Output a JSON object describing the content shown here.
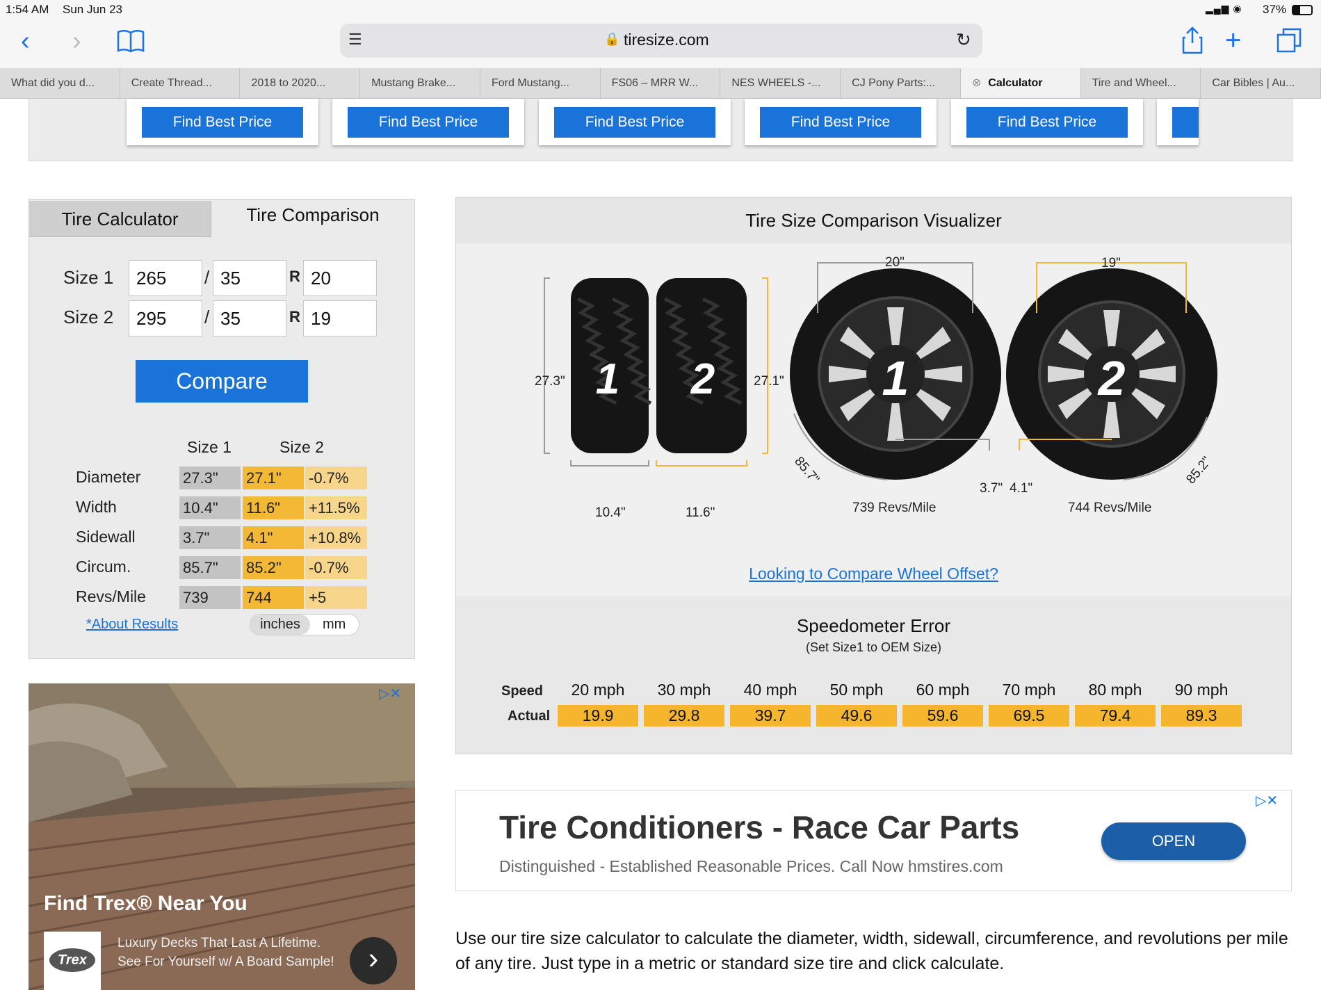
{
  "status": {
    "time": "1:54 AM",
    "date": "Sun Jun 23",
    "battery": "37%"
  },
  "browser": {
    "url": "tiresize.com"
  },
  "tabs": [
    "What did you d...",
    "Create Thread...",
    "2018 to 2020...",
    "Mustang Brake...",
    "Ford Mustang...",
    "FS06 – MRR W...",
    "NES WHEELS -...",
    "CJ Pony Parts:...",
    "Calculator",
    "Tire and Wheel...",
    "Car Bibles | Au..."
  ],
  "price_button": "Find Best Price",
  "calc": {
    "tab1": "Tire Calculator",
    "tab2": "Tire Comparison",
    "size1_label": "Size 1",
    "size2_label": "Size 2",
    "size1": {
      "width": "265",
      "ratio": "35",
      "rim": "20"
    },
    "size2": {
      "width": "295",
      "ratio": "35",
      "rim": "19"
    },
    "slash": "/",
    "r": "R",
    "compare": "Compare",
    "col1": "Size 1",
    "col2": "Size 2",
    "rows": [
      {
        "label": "Diameter",
        "s1": "27.3\"",
        "s2": "27.1\"",
        "diff": "-0.7%"
      },
      {
        "label": "Width",
        "s1": "10.4\"",
        "s2": "11.6\"",
        "diff": "+11.5%"
      },
      {
        "label": "Sidewall",
        "s1": "3.7\"",
        "s2": "4.1\"",
        "diff": "+10.8%"
      },
      {
        "label": "Circum.",
        "s1": "85.7\"",
        "s2": "85.2\"",
        "diff": "-0.7%"
      },
      {
        "label": "Revs/Mile",
        "s1": "739",
        "s2": "744",
        "diff": "+5"
      }
    ],
    "about": "*About Results",
    "unit_inches": "inches",
    "unit_mm": "mm"
  },
  "viz": {
    "title": "Tire Size Comparison Visualizer",
    "tire1_label": "1",
    "tire2_label": "2",
    "d1": "27.3\"",
    "d2": "27.1\"",
    "w1": "10.4\"",
    "w2": "11.6\"",
    "rim1": "20\"",
    "rim2": "19\"",
    "circ1": "85.7\"",
    "circ2": "85.2\"",
    "side1": "3.7\"",
    "side2": "4.1\"",
    "revs1": "739 Revs/Mile",
    "revs2": "744 Revs/Mile",
    "offset_link": "Looking to Compare Wheel Offset?",
    "speedo_title": "Speedometer Error",
    "speedo_sub": "(Set Size1 to OEM Size)",
    "speed_label": "Speed",
    "actual_label": "Actual",
    "speeds": [
      "20 mph",
      "30 mph",
      "40 mph",
      "50 mph",
      "60 mph",
      "70 mph",
      "80 mph",
      "90 mph"
    ],
    "actuals": [
      "19.9",
      "29.8",
      "39.7",
      "49.6",
      "59.6",
      "69.5",
      "79.4",
      "89.3"
    ]
  },
  "ad": {
    "title": "Tire Conditioners - Race Car Parts",
    "text": "Distinguished - Established Reasonable Prices. Call Now hmstires.com",
    "button": "OPEN"
  },
  "leftad": {
    "title": "Find Trex® Near You",
    "text": "Luxury Decks That Last A Lifetime. See For Yourself w/ A Board Sample!",
    "logo": "Trex"
  },
  "description": "Use our tire size calculator to calculate the diameter, width, sidewall, circumference, and revolutions per mile of any tire. Just type in a metric or standard size tire and click calculate.",
  "colors": {
    "blue": "#1a73d9",
    "orange": "#f2b836",
    "grey": "#c3c3c3"
  }
}
